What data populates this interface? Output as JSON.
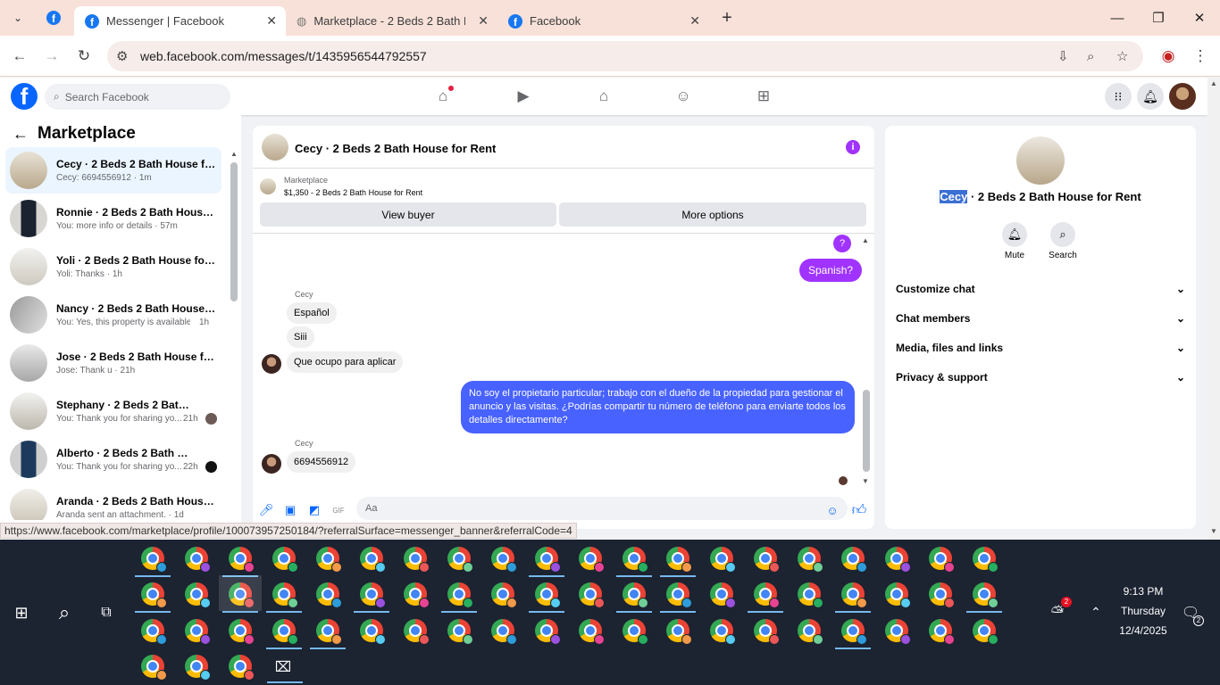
{
  "browser": {
    "tabs": [
      {
        "title": "Messenger | Facebook",
        "active": true
      },
      {
        "title": "Marketplace - 2 Beds 2 Bath Ho",
        "active": false
      },
      {
        "title": "Facebook",
        "active": false
      }
    ],
    "url": "web.facebook.com/messages/t/1435956544792557",
    "status_url": "https://www.facebook.com/marketplace/profile/100073957250184/?referralSurface=messenger_banner&referralCode=4"
  },
  "facebook": {
    "search_placeholder": "Search Facebook",
    "accent": "#0866ff"
  },
  "sidebar": {
    "title": "Marketplace",
    "conversations": [
      {
        "name": "Cecy · 2 Beds 2 Bath House for Rent",
        "preview": "Cecy: 6694556912 · 1m",
        "time": "",
        "selected": true
      },
      {
        "name": "Ronnie · 2 Beds 2 Bath House for Rent",
        "preview": "You: more info or details · 57m",
        "time": ""
      },
      {
        "name": "Yoli · 2 Beds 2 Bath House for Rent",
        "preview": "Yoli: Thanks · 1h",
        "time": ""
      },
      {
        "name": "Nancy · 2 Beds 2 Bath House for Rent",
        "preview": "You: Yes, this property is available ...",
        "time": "1h"
      },
      {
        "name": "Jose · 2 Beds 2 Bath House for Rent",
        "preview": "Jose: Thank u · 21h",
        "time": ""
      },
      {
        "name": "Stephany · 2 Beds 2 Bath House for Rent",
        "preview": "You: Thank you for sharing yo...",
        "time": "21h"
      },
      {
        "name": "Alberto · 2 Beds 2 Bath House for Rent",
        "preview": "You: Thank you for sharing yo...",
        "time": "22h"
      },
      {
        "name": "Aranda · 2 Beds 2 Bath House for Rent",
        "preview": "Aranda sent an attachment. · 1d",
        "time": ""
      }
    ]
  },
  "chat": {
    "title": "Cecy · 2 Beds 2 Bath House for Rent",
    "banner_source": "Marketplace",
    "banner_listing": "$1,350 - 2 Beds 2 Bath House for Rent",
    "view_buyer": "View buyer",
    "more_options": "More options",
    "messages": {
      "out_1": "?",
      "out_2": "Spanish?",
      "sender_1": "Cecy",
      "in_1": "Español",
      "in_2": "Siii",
      "in_3": "Que ocupo para aplicar",
      "out_long": "No soy el propietario particular; trabajo con el dueño de la propiedad para gestionar el anuncio y las visitas. ¿Podrías compartir tu número de teléfono para enviarte todos los detalles directamente?",
      "sender_2": "Cecy",
      "in_4": "6694556912"
    },
    "composer_placeholder": "Aa"
  },
  "details": {
    "name_highlight": "Cecy",
    "name_rest": " · 2 Beds 2 Bath House for Rent",
    "mute": "Mute",
    "search": "Search",
    "sections": [
      "Customize chat",
      "Chat members",
      "Media, files and links",
      "Privacy & support"
    ]
  },
  "taskbar": {
    "time": "9:13 PM",
    "day": "Thursday",
    "date": "12/4/2025",
    "notifications": "2",
    "weather_badge": "2"
  }
}
